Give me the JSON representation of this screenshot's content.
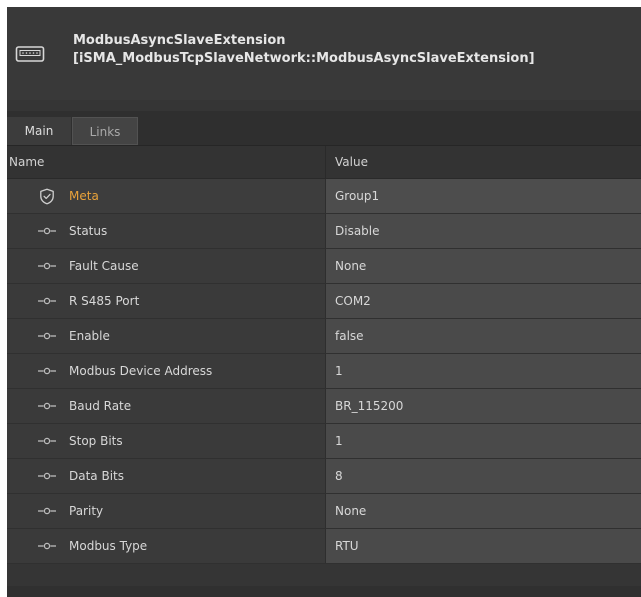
{
  "header": {
    "title": "ModbusAsyncSlaveExtension",
    "subtitle": "[iSMA_ModbusTcpSlaveNetwork::ModbusAsyncSlaveExtension]",
    "icon": "serial-port-icon"
  },
  "tabs": [
    {
      "label": "Main",
      "active": true
    },
    {
      "label": "Links",
      "active": false
    }
  ],
  "table": {
    "columns": {
      "name": "Name",
      "value": "Value"
    },
    "rows": [
      {
        "label": "Meta",
        "value": "Group1",
        "icon": "shield-check-icon"
      },
      {
        "label": "Status",
        "value": "Disable",
        "icon": "slot-connector-icon"
      },
      {
        "label": "Fault Cause",
        "value": "None",
        "icon": "slot-connector-icon"
      },
      {
        "label": "R S485 Port",
        "value": "COM2",
        "icon": "slot-connector-icon"
      },
      {
        "label": "Enable",
        "value": "false",
        "icon": "slot-connector-icon"
      },
      {
        "label": "Modbus Device Address",
        "value": "1",
        "icon": "slot-connector-icon"
      },
      {
        "label": "Baud Rate",
        "value": "BR_115200",
        "icon": "slot-connector-icon"
      },
      {
        "label": "Stop Bits",
        "value": "1",
        "icon": "slot-connector-icon"
      },
      {
        "label": "Data Bits",
        "value": "8",
        "icon": "slot-connector-icon"
      },
      {
        "label": "Parity",
        "value": "None",
        "icon": "slot-connector-icon"
      },
      {
        "label": "Modbus Type",
        "value": "RTU",
        "icon": "slot-connector-icon"
      }
    ]
  },
  "colors": {
    "panel_bg": "#353535",
    "meta_label": "#e8a23a",
    "text": "#d8d8d8"
  }
}
